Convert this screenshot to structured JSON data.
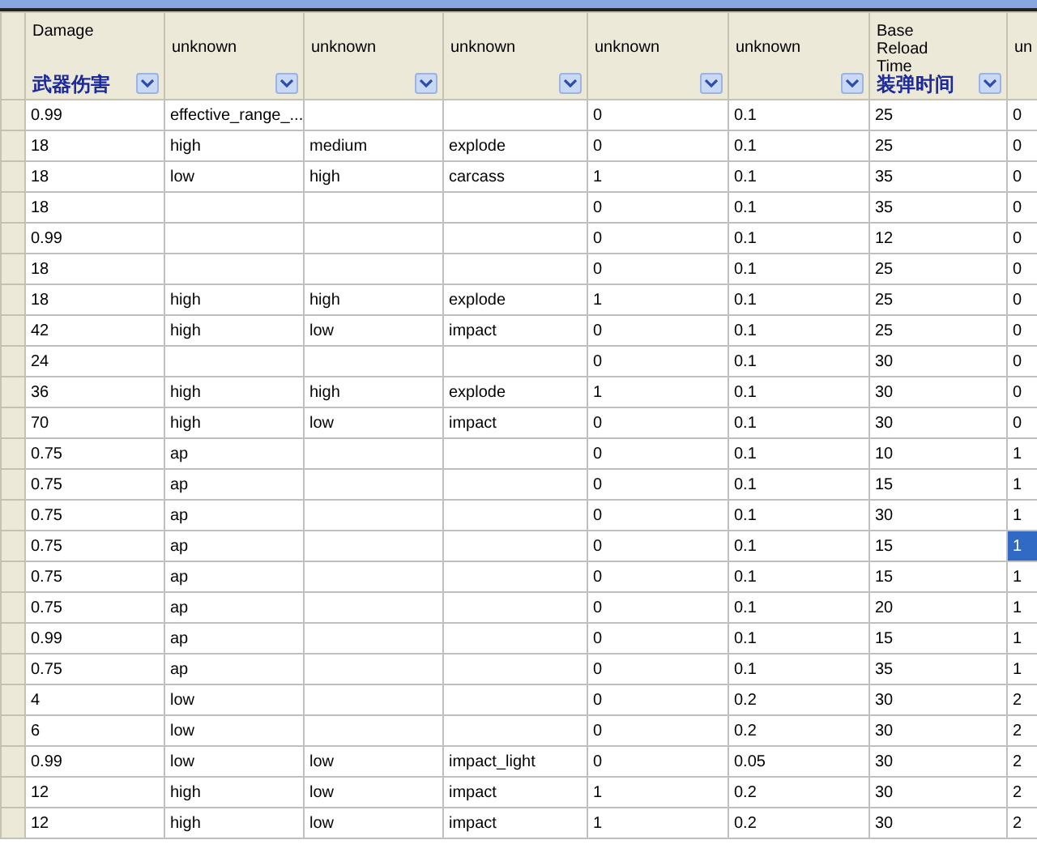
{
  "table": {
    "columns": [
      {
        "label": "Damage",
        "note": "武器伤害"
      },
      {
        "label": "unknown"
      },
      {
        "label": "unknown"
      },
      {
        "label": "unknown"
      },
      {
        "label": "unknown"
      },
      {
        "label": "unknown"
      },
      {
        "label": "Base Reload Time",
        "note": "装弹时间"
      },
      {
        "label": "un"
      }
    ],
    "rows": [
      [
        {
          "t": "0.99",
          "selected": false
        },
        {
          "t": "effective_range_...",
          "selected": false
        },
        {
          "selected": false
        },
        {
          "selected": false
        },
        {
          "t": "0",
          "selected": false
        },
        {
          "t": "0.1",
          "selected": false
        },
        {
          "t": "25",
          "selected": false
        },
        {
          "t": "0",
          "selected": false
        }
      ],
      [
        {
          "t": "18",
          "selected": false
        },
        {
          "t": "high",
          "selected": false
        },
        {
          "t": "medium",
          "selected": false
        },
        {
          "t": "explode",
          "selected": false
        },
        {
          "t": "0",
          "selected": false
        },
        {
          "t": "0.1",
          "selected": false
        },
        {
          "t": "25",
          "selected": false
        },
        {
          "t": "0",
          "selected": false
        }
      ],
      [
        {
          "t": "18",
          "selected": false
        },
        {
          "t": "low",
          "selected": false
        },
        {
          "t": "high",
          "selected": false
        },
        {
          "t": "carcass",
          "selected": false
        },
        {
          "t": "1",
          "selected": false
        },
        {
          "t": "0.1",
          "selected": false
        },
        {
          "t": "35",
          "selected": false
        },
        {
          "t": "0",
          "selected": false
        }
      ],
      [
        {
          "t": "18",
          "selected": false
        },
        {
          "selected": false
        },
        {
          "selected": false
        },
        {
          "selected": false
        },
        {
          "t": "0",
          "selected": false
        },
        {
          "t": "0.1",
          "selected": false
        },
        {
          "t": "35",
          "selected": false
        },
        {
          "t": "0",
          "selected": false
        }
      ],
      [
        {
          "t": "0.99",
          "selected": false
        },
        {
          "selected": false
        },
        {
          "selected": false
        },
        {
          "selected": false
        },
        {
          "t": "0",
          "selected": false
        },
        {
          "t": "0.1",
          "selected": false
        },
        {
          "t": "12",
          "selected": false
        },
        {
          "t": "0",
          "selected": false
        }
      ],
      [
        {
          "t": "18",
          "selected": false
        },
        {
          "selected": false
        },
        {
          "selected": false
        },
        {
          "selected": false
        },
        {
          "t": "0",
          "selected": false
        },
        {
          "t": "0.1",
          "selected": false
        },
        {
          "t": "25",
          "selected": false
        },
        {
          "t": "0",
          "selected": false
        }
      ],
      [
        {
          "t": "18",
          "selected": false
        },
        {
          "t": "high",
          "selected": false
        },
        {
          "t": "high",
          "selected": false
        },
        {
          "t": "explode",
          "selected": false
        },
        {
          "t": "1",
          "selected": false
        },
        {
          "t": "0.1",
          "selected": false
        },
        {
          "t": "25",
          "selected": false
        },
        {
          "t": "0",
          "selected": false
        }
      ],
      [
        {
          "t": "42",
          "selected": false
        },
        {
          "t": "high",
          "selected": false
        },
        {
          "t": "low",
          "selected": false
        },
        {
          "t": "impact",
          "selected": false
        },
        {
          "t": "0",
          "selected": false
        },
        {
          "t": "0.1",
          "selected": false
        },
        {
          "t": "25",
          "selected": false
        },
        {
          "t": "0",
          "selected": false
        }
      ],
      [
        {
          "t": "24",
          "selected": false
        },
        {
          "selected": false
        },
        {
          "selected": false
        },
        {
          "selected": false
        },
        {
          "t": "0",
          "selected": false
        },
        {
          "t": "0.1",
          "selected": false
        },
        {
          "t": "30",
          "selected": false
        },
        {
          "t": "0",
          "selected": false
        }
      ],
      [
        {
          "t": "36",
          "selected": false
        },
        {
          "t": "high",
          "selected": false
        },
        {
          "t": "high",
          "selected": false
        },
        {
          "t": "explode",
          "selected": false
        },
        {
          "t": "1",
          "selected": false
        },
        {
          "t": "0.1",
          "selected": false
        },
        {
          "t": "30",
          "selected": false
        },
        {
          "t": "0",
          "selected": false
        }
      ],
      [
        {
          "t": "70",
          "selected": false
        },
        {
          "t": "high",
          "selected": false
        },
        {
          "t": "low",
          "selected": false
        },
        {
          "t": "impact",
          "selected": false
        },
        {
          "t": "0",
          "selected": false
        },
        {
          "t": "0.1",
          "selected": false
        },
        {
          "t": "30",
          "selected": false
        },
        {
          "t": "0",
          "selected": false
        }
      ],
      [
        {
          "t": "0.75",
          "selected": false
        },
        {
          "t": "ap",
          "selected": false
        },
        {
          "selected": false
        },
        {
          "selected": false
        },
        {
          "t": "0",
          "selected": false
        },
        {
          "t": "0.1",
          "selected": false
        },
        {
          "t": "10",
          "selected": false
        },
        {
          "t": "1",
          "selected": false
        }
      ],
      [
        {
          "t": "0.75",
          "selected": false
        },
        {
          "t": "ap",
          "selected": false
        },
        {
          "selected": false
        },
        {
          "selected": false
        },
        {
          "t": "0",
          "selected": false
        },
        {
          "t": "0.1",
          "selected": false
        },
        {
          "t": "15",
          "selected": false
        },
        {
          "t": "1",
          "selected": false
        }
      ],
      [
        {
          "t": "0.75",
          "selected": false
        },
        {
          "t": "ap",
          "selected": false
        },
        {
          "selected": false
        },
        {
          "selected": false
        },
        {
          "t": "0",
          "selected": false
        },
        {
          "t": "0.1",
          "selected": false
        },
        {
          "t": "30",
          "selected": false
        },
        {
          "t": "1",
          "selected": false
        }
      ],
      [
        {
          "t": "0.75",
          "selected": false
        },
        {
          "t": "ap",
          "selected": false
        },
        {
          "selected": false
        },
        {
          "selected": false
        },
        {
          "t": "0",
          "selected": false
        },
        {
          "t": "0.1",
          "selected": false
        },
        {
          "t": "15",
          "selected": false
        },
        {
          "t": "1",
          "selected": true
        }
      ],
      [
        {
          "t": "0.75",
          "selected": false
        },
        {
          "t": "ap",
          "selected": false
        },
        {
          "selected": false
        },
        {
          "selected": false
        },
        {
          "t": "0",
          "selected": false
        },
        {
          "t": "0.1",
          "selected": false
        },
        {
          "t": "15",
          "selected": false
        },
        {
          "t": "1",
          "selected": false
        }
      ],
      [
        {
          "t": "0.75",
          "selected": false
        },
        {
          "t": "ap",
          "selected": false
        },
        {
          "selected": false
        },
        {
          "selected": false
        },
        {
          "t": "0",
          "selected": false
        },
        {
          "t": "0.1",
          "selected": false
        },
        {
          "t": "20",
          "selected": false
        },
        {
          "t": "1",
          "selected": false
        }
      ],
      [
        {
          "t": "0.99",
          "selected": false
        },
        {
          "t": "ap",
          "selected": false
        },
        {
          "selected": false
        },
        {
          "selected": false
        },
        {
          "t": "0",
          "selected": false
        },
        {
          "t": "0.1",
          "selected": false
        },
        {
          "t": "15",
          "selected": false
        },
        {
          "t": "1",
          "selected": false
        }
      ],
      [
        {
          "t": "0.75",
          "selected": false
        },
        {
          "t": "ap",
          "selected": false
        },
        {
          "selected": false
        },
        {
          "selected": false
        },
        {
          "t": "0",
          "selected": false
        },
        {
          "t": "0.1",
          "selected": false
        },
        {
          "t": "35",
          "selected": false
        },
        {
          "t": "1",
          "selected": false
        }
      ],
      [
        {
          "t": "4",
          "selected": false
        },
        {
          "t": "low",
          "selected": false
        },
        {
          "selected": false
        },
        {
          "selected": false
        },
        {
          "t": "0",
          "selected": false
        },
        {
          "t": "0.2",
          "selected": false
        },
        {
          "t": "30",
          "selected": false
        },
        {
          "t": "2",
          "selected": false
        }
      ],
      [
        {
          "t": "6",
          "selected": false
        },
        {
          "t": "low",
          "selected": false
        },
        {
          "selected": false
        },
        {
          "selected": false
        },
        {
          "t": "0",
          "selected": false
        },
        {
          "t": "0.2",
          "selected": false
        },
        {
          "t": "30",
          "selected": false
        },
        {
          "t": "2",
          "selected": false
        }
      ],
      [
        {
          "t": "0.99",
          "selected": false
        },
        {
          "t": "low",
          "selected": false
        },
        {
          "t": "low",
          "selected": false
        },
        {
          "t": "impact_light",
          "selected": false
        },
        {
          "t": "0",
          "selected": false
        },
        {
          "t": "0.05",
          "selected": false
        },
        {
          "t": "30",
          "selected": false
        },
        {
          "t": "2",
          "selected": false
        }
      ],
      [
        {
          "t": "12",
          "selected": false
        },
        {
          "t": "high",
          "selected": false
        },
        {
          "t": "low",
          "selected": false
        },
        {
          "t": "impact",
          "selected": false
        },
        {
          "t": "1",
          "selected": false
        },
        {
          "t": "0.2",
          "selected": false
        },
        {
          "t": "30",
          "selected": false
        },
        {
          "t": "2",
          "selected": false
        }
      ],
      [
        {
          "t": "12",
          "selected": false
        },
        {
          "t": "high",
          "selected": false
        },
        {
          "t": "low",
          "selected": false
        },
        {
          "t": "impact",
          "selected": false
        },
        {
          "t": "1",
          "selected": false
        },
        {
          "t": "0.2",
          "selected": false
        },
        {
          "t": "30",
          "selected": false
        },
        {
          "t": "2",
          "selected": false
        }
      ]
    ]
  }
}
